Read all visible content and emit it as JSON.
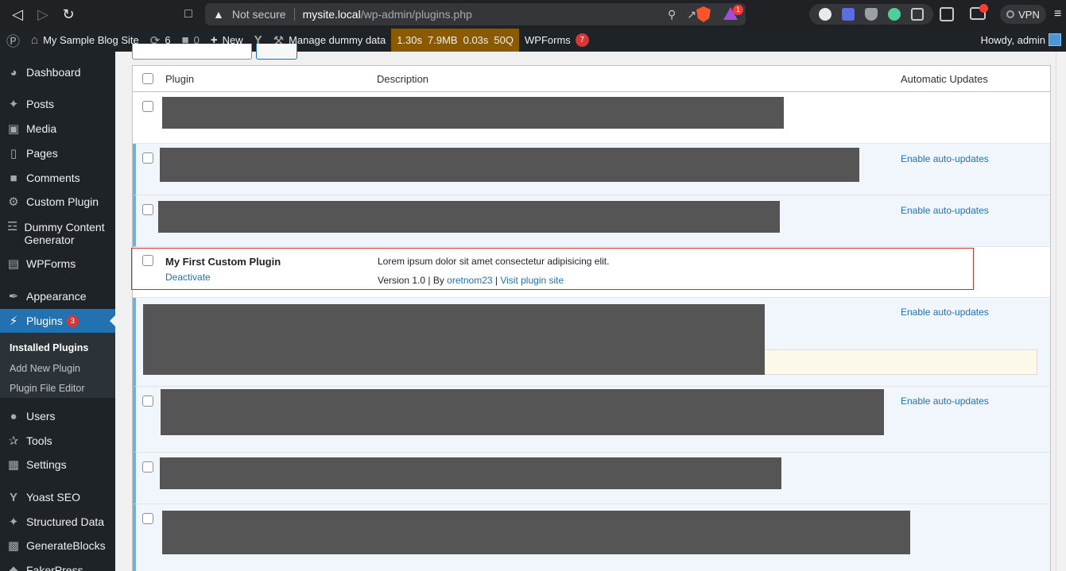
{
  "browser": {
    "not_secure": "Not secure",
    "url_host": "mysite.local",
    "url_path": "/wp-admin/plugins.php",
    "rewards_badge": "1",
    "vpn_label": "VPN"
  },
  "adminbar": {
    "site_name": "My Sample Blog Site",
    "updates_count": "6",
    "comments_count": "0",
    "new_label": "New",
    "dummy_data": "Manage dummy data",
    "qm_time": "1.30s",
    "qm_memory": "7.9MB",
    "qm_db_time": "0.03s",
    "qm_queries": "50Q",
    "wpforms_label": "WPForms",
    "wpforms_count": "7",
    "howdy": "Howdy, admin"
  },
  "sidebar": {
    "items": [
      {
        "label": "Dashboard"
      },
      {
        "label": "Posts"
      },
      {
        "label": "Media"
      },
      {
        "label": "Pages"
      },
      {
        "label": "Comments"
      },
      {
        "label": "Custom Plugin"
      },
      {
        "label": "Dummy Content Generator"
      },
      {
        "label": "WPForms"
      },
      {
        "label": "Appearance"
      },
      {
        "label": "Plugins",
        "badge": "3"
      },
      {
        "label": "Users"
      },
      {
        "label": "Tools"
      },
      {
        "label": "Settings"
      },
      {
        "label": "Yoast SEO"
      },
      {
        "label": "Structured Data"
      },
      {
        "label": "GenerateBlocks"
      },
      {
        "label": "FakerPress"
      }
    ],
    "submenu": [
      "Installed Plugins",
      "Add New Plugin",
      "Plugin File Editor"
    ]
  },
  "table": {
    "headers": {
      "plugin": "Plugin",
      "description": "Description",
      "auto_updates": "Automatic Updates"
    },
    "enable_auto_updates": "Enable auto-updates",
    "highlighted_plugin": {
      "name": "My First Custom Plugin",
      "action": "Deactivate",
      "description": "Lorem ipsum dolor sit amet consectetur adipisicing elit.",
      "version_prefix": "Version 1.0 | By ",
      "author": "oretnom23",
      "separator": " | ",
      "site_link": "Visit plugin site"
    }
  }
}
